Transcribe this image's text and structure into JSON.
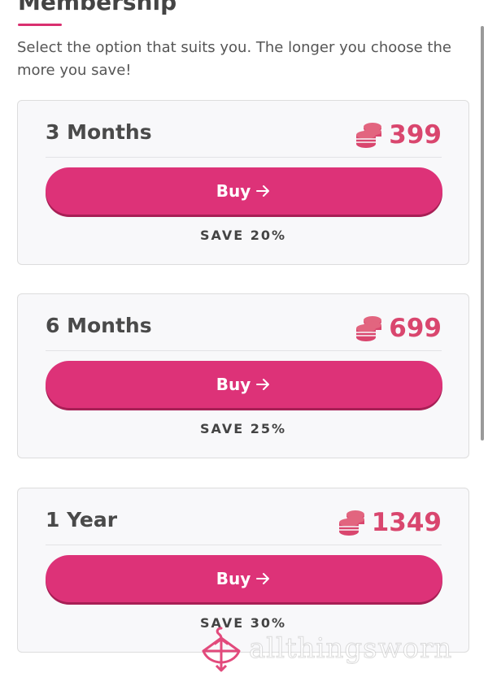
{
  "header": {
    "title": "Membership",
    "accent_color": "#d9306f"
  },
  "intro": {
    "text": "Select the option that suits you. The longer you choose the more you save!"
  },
  "plans": [
    {
      "title": "3 Months",
      "price": "399",
      "button_label": "Buy",
      "save_text": "SAVE 20%"
    },
    {
      "title": "6 Months",
      "price": "699",
      "button_label": "Buy",
      "save_text": "SAVE 25%"
    },
    {
      "title": "1 Year",
      "price": "1349",
      "button_label": "Buy",
      "save_text": "SAVE 30%"
    }
  ],
  "icons": {
    "price": "coins-icon",
    "button": "arrow-right-icon",
    "watermark": "hanger-bow-logo"
  },
  "colors": {
    "button": "#dd3278",
    "price": "#d9466e",
    "card_background": "#f8f8fa"
  },
  "watermark": {
    "text": "allthingsworn"
  }
}
